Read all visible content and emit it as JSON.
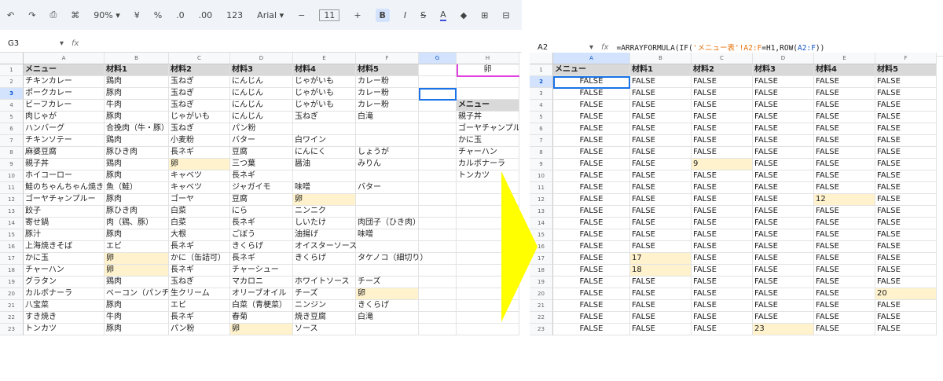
{
  "left": {
    "toolbar": {
      "undo": "↶",
      "redo": "↷",
      "print": "⎙",
      "paint": "⌘",
      "zoom": "90% ▾",
      "currency": "¥",
      "percent": "%",
      "dec_less": ".0",
      "dec_more": ".00",
      "format123": "123",
      "font": "Arial ▾",
      "minus": "−",
      "font_size": "11",
      "plus": "+",
      "bold": "B",
      "italic": "I",
      "strike": "S",
      "text_color": "A",
      "fill": "◆",
      "borders": "⊞",
      "merge": "⊟",
      "align": "☰ ▾"
    },
    "namebox": "G3",
    "fx": "fx",
    "dropdown": "▾",
    "columns": [
      "A",
      "B",
      "C",
      "D",
      "E",
      "F",
      "G",
      "H"
    ],
    "rows": [
      [
        "メニュー",
        "材料1",
        "材料2",
        "材料3",
        "材料4",
        "材料5",
        "",
        "卵"
      ],
      [
        "チキンカレー",
        "鶏肉",
        "玉ねぎ",
        "にんじん",
        "じゃがいも",
        "カレー粉",
        "",
        ""
      ],
      [
        "ポークカレー",
        "豚肉",
        "玉ねぎ",
        "にんじん",
        "じゃがいも",
        "カレー粉",
        "",
        ""
      ],
      [
        "ビーフカレー",
        "牛肉",
        "玉ねぎ",
        "にんじん",
        "じゃがいも",
        "カレー粉",
        "",
        "メニュー"
      ],
      [
        "肉じゃが",
        "豚肉",
        "じゃがいも",
        "にんじん",
        "玉ねぎ",
        "白滝",
        "",
        "親子丼"
      ],
      [
        "ハンバーグ",
        "合挽肉（牛・豚）",
        "玉ねぎ",
        "パン粉",
        "",
        "",
        "",
        "ゴーヤチャンプルー"
      ],
      [
        "チキンソテー",
        "鶏肉",
        "小麦粉",
        "バター",
        "白ワイン",
        "",
        "",
        "かに玉"
      ],
      [
        "麻婆豆腐",
        "豚ひき肉",
        "長ネギ",
        "豆腐",
        "にんにく",
        "しょうが",
        "",
        "チャーハン"
      ],
      [
        "親子丼",
        "鶏肉",
        "卵",
        "三つ葉",
        "醤油",
        "みりん",
        "",
        "カルボナーラ"
      ],
      [
        "ホイコーロー",
        "豚肉",
        "キャベツ",
        "長ネギ",
        "",
        "",
        "",
        "トンカツ"
      ],
      [
        "鮭のちゃんちゃん焼き",
        "魚（鮭）",
        "キャベツ",
        "ジャガイモ",
        "味噌",
        "バター",
        "",
        ""
      ],
      [
        "ゴーヤチャンプルー",
        "豚肉",
        "ゴーヤ",
        "豆腐",
        "卵",
        "",
        "",
        ""
      ],
      [
        "餃子",
        "豚ひき肉",
        "白菜",
        "にら",
        "ニンニク",
        "",
        "",
        ""
      ],
      [
        "寄せ鍋",
        "肉（鶏、豚）",
        "白菜",
        "長ネギ",
        "しいたけ",
        "肉団子（ひき肉）",
        "",
        ""
      ],
      [
        "豚汁",
        "豚肉",
        "大根",
        "ごぼう",
        "油揚げ",
        "味噌",
        "",
        ""
      ],
      [
        "上海焼きそば",
        "エビ",
        "長ネギ",
        "きくらげ",
        "オイスターソース",
        "",
        "",
        ""
      ],
      [
        "かに玉",
        "卵",
        "かに（缶詰可）",
        "長ネギ",
        "きくらげ",
        "タケノコ（細切り）",
        "",
        ""
      ],
      [
        "チャーハン",
        "卵",
        "長ネギ",
        "チャーシュー",
        "",
        "",
        "",
        ""
      ],
      [
        "グラタン",
        "鶏肉",
        "玉ねぎ",
        "マカロニ",
        "ホワイトソース",
        "チーズ",
        "",
        ""
      ],
      [
        "カルボナーラ",
        "ベーコン（パンチェッタ）",
        "生クリーム",
        "オリーブオイル",
        "チーズ",
        "卵",
        "",
        ""
      ],
      [
        "八宝菜",
        "豚肉",
        "エビ",
        "白菜（青梗菜）",
        "ニンジン",
        "きくらげ",
        "",
        ""
      ],
      [
        "すき焼き",
        "牛肉",
        "長ネギ",
        "春菊",
        "焼き豆腐",
        "白滝",
        "",
        ""
      ],
      [
        "トンカツ",
        "豚肉",
        "パン粉",
        "卵",
        "ソース",
        "",
        "",
        ""
      ]
    ]
  },
  "right": {
    "namebox": "A2",
    "fx": "fx",
    "dropdown": "▾",
    "formula": {
      "p1": "=ARRAYFORMULA(IF(",
      "p2": "'メニュー表'!A2:F",
      "p3": "=H1,ROW(",
      "p4": "A2:F",
      "p5": "))"
    },
    "columns": [
      "A",
      "B",
      "C",
      "D",
      "E",
      "F"
    ],
    "rows": [
      [
        "メニュー",
        "材料1",
        "材料2",
        "材料3",
        "材料4",
        "材料5"
      ],
      [
        "FALSE",
        "FALSE",
        "FALSE",
        "FALSE",
        "FALSE",
        "FALSE"
      ],
      [
        "FALSE",
        "FALSE",
        "FALSE",
        "FALSE",
        "FALSE",
        "FALSE"
      ],
      [
        "FALSE",
        "FALSE",
        "FALSE",
        "FALSE",
        "FALSE",
        "FALSE"
      ],
      [
        "FALSE",
        "FALSE",
        "FALSE",
        "FALSE",
        "FALSE",
        "FALSE"
      ],
      [
        "FALSE",
        "FALSE",
        "FALSE",
        "FALSE",
        "FALSE",
        "FALSE"
      ],
      [
        "FALSE",
        "FALSE",
        "FALSE",
        "FALSE",
        "FALSE",
        "FALSE"
      ],
      [
        "FALSE",
        "FALSE",
        "FALSE",
        "FALSE",
        "FALSE",
        "FALSE"
      ],
      [
        "FALSE",
        "FALSE",
        "9",
        "FALSE",
        "FALSE",
        "FALSE"
      ],
      [
        "FALSE",
        "FALSE",
        "FALSE",
        "FALSE",
        "FALSE",
        "FALSE"
      ],
      [
        "FALSE",
        "FALSE",
        "FALSE",
        "FALSE",
        "FALSE",
        "FALSE"
      ],
      [
        "FALSE",
        "FALSE",
        "FALSE",
        "FALSE",
        "12",
        "FALSE"
      ],
      [
        "FALSE",
        "FALSE",
        "FALSE",
        "FALSE",
        "FALSE",
        "FALSE"
      ],
      [
        "FALSE",
        "FALSE",
        "FALSE",
        "FALSE",
        "FALSE",
        "FALSE"
      ],
      [
        "FALSE",
        "FALSE",
        "FALSE",
        "FALSE",
        "FALSE",
        "FALSE"
      ],
      [
        "FALSE",
        "FALSE",
        "FALSE",
        "FALSE",
        "FALSE",
        "FALSE"
      ],
      [
        "FALSE",
        "17",
        "FALSE",
        "FALSE",
        "FALSE",
        "FALSE"
      ],
      [
        "FALSE",
        "18",
        "FALSE",
        "FALSE",
        "FALSE",
        "FALSE"
      ],
      [
        "FALSE",
        "FALSE",
        "FALSE",
        "FALSE",
        "FALSE",
        "FALSE"
      ],
      [
        "FALSE",
        "FALSE",
        "FALSE",
        "FALSE",
        "FALSE",
        "20"
      ],
      [
        "FALSE",
        "FALSE",
        "FALSE",
        "FALSE",
        "FALSE",
        "FALSE"
      ],
      [
        "FALSE",
        "FALSE",
        "FALSE",
        "FALSE",
        "FALSE",
        "FALSE"
      ],
      [
        "FALSE",
        "FALSE",
        "FALSE",
        "23",
        "FALSE",
        "FALSE"
      ]
    ]
  },
  "colors": {
    "highlight": "#fff2cc",
    "header": "#d9d9d9",
    "selection": "#1a73e8",
    "arrow": "#ffff00",
    "accent": "#e040e0"
  }
}
